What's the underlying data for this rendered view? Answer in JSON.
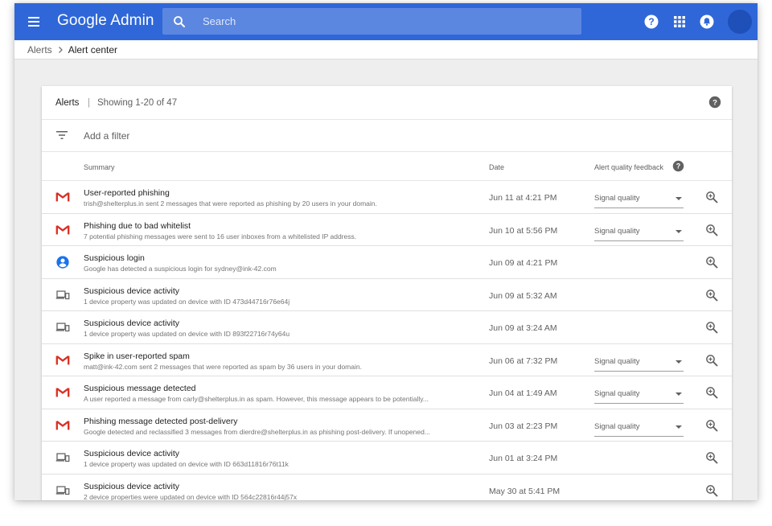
{
  "app": {
    "brand": "Google Admin",
    "search_placeholder": "Search",
    "topbar_icons": [
      "help-icon",
      "apps-grid-icon",
      "notifications-icon"
    ],
    "brand_color": "#2f67d8"
  },
  "breadcrumb": {
    "parent": "Alerts",
    "current": "Alert center"
  },
  "card": {
    "title": "Alerts",
    "divider": "|",
    "count": "Showing 1-20 of 47",
    "filter_label": "Add a filter"
  },
  "table": {
    "columns": {
      "summary": "Summary",
      "date": "Date",
      "quality": "Alert quality feedback"
    },
    "rows": [
      {
        "icon": "gmail-icon",
        "title": "User-reported phishing",
        "desc": "trish@shelterplus.in sent 2 messages that were reported as phishing by 20 users in your domain.",
        "date": "Jun 11 at 4:21 PM",
        "quality": "Signal quality"
      },
      {
        "icon": "gmail-icon",
        "title": "Phishing due to bad whitelist",
        "desc": "7 potential phishing messages were sent to 16 user inboxes from a whitelisted IP address.",
        "date": "Jun 10 at 5:56 PM",
        "quality": "Signal quality"
      },
      {
        "icon": "user-icon",
        "title": "Suspicious login",
        "desc": "Google has detected a suspicious login for sydney@ink-42.com",
        "date": "Jun 09 at 4:21 PM",
        "quality": null
      },
      {
        "icon": "devices-icon",
        "title": "Suspicious device activity",
        "desc": "1 device property was updated on device with ID 473d44716r76e64j",
        "date": "Jun 09 at 5:32 AM",
        "quality": null
      },
      {
        "icon": "devices-icon",
        "title": "Suspicious device activity",
        "desc": "1 device property was updated on device with ID 893f22716r74y64u",
        "date": "Jun 09 at 3:24 AM",
        "quality": null
      },
      {
        "icon": "gmail-icon",
        "title": "Spike in user-reported spam",
        "desc": "matt@ink-42.com sent 2 messages that were reported as spam by 36 users in your domain.",
        "date": "Jun 06 at 7:32 PM",
        "quality": "Signal quality"
      },
      {
        "icon": "gmail-icon",
        "title": "Suspicious message detected",
        "desc": "A user reported a message from carly@shelterplus.in as spam. However, this message appears to be potentially...",
        "date": "Jun 04 at 1:49 AM",
        "quality": "Signal quality"
      },
      {
        "icon": "gmail-icon",
        "title": "Phishing message detected post-delivery",
        "desc": "Google detected and reclassified 3 messages from dierdre@shelterplus.in as phishing post-delivery. If unopened...",
        "date": "Jun 03 at 2:23 PM",
        "quality": "Signal quality"
      },
      {
        "icon": "devices-icon",
        "title": "Suspicious device activity",
        "desc": "1 device property was updated on device with ID 663d11816r76t11k",
        "date": "Jun 01 at 3:24 PM",
        "quality": null
      },
      {
        "icon": "devices-icon",
        "title": "Suspicious device activity",
        "desc": "2 device properties were updated on device with ID 564c22816r44j57x",
        "date": "May 30 at 5:41 PM",
        "quality": null
      }
    ]
  }
}
